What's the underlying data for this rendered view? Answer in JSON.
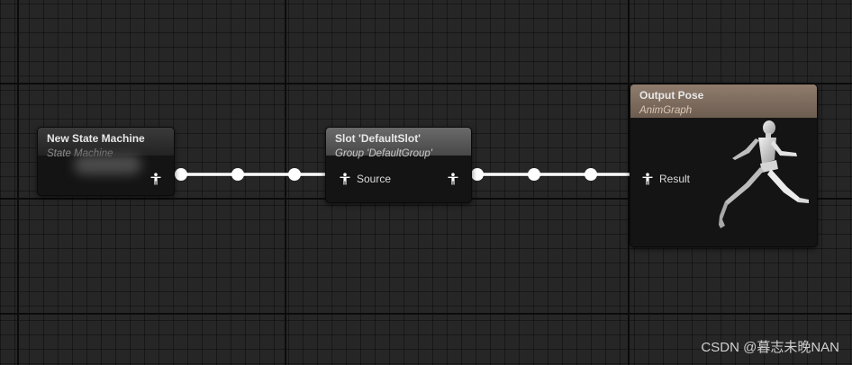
{
  "nodes": {
    "state_machine": {
      "title": "New State Machine",
      "subtitle": "State Machine",
      "header_color": "#2f2f2f"
    },
    "slot": {
      "title": "Slot 'DefaultSlot'",
      "subtitle": "Group 'DefaultGroup'",
      "input_pin_label": "Source",
      "header_color": "#5a5a5a"
    },
    "output_pose": {
      "title": "Output Pose",
      "subtitle": "AnimGraph",
      "input_pin_label": "Result",
      "header_color": "#7f6c5e",
      "preview_icon": "running-mannequin-icon"
    }
  },
  "pins": {
    "icon": "pose-pin-icon",
    "color": "#ffffff"
  },
  "wire": {
    "color": "#ffffff"
  },
  "canvas": {
    "background": "#262626"
  },
  "watermark": "CSDN @暮志未晚NAN"
}
